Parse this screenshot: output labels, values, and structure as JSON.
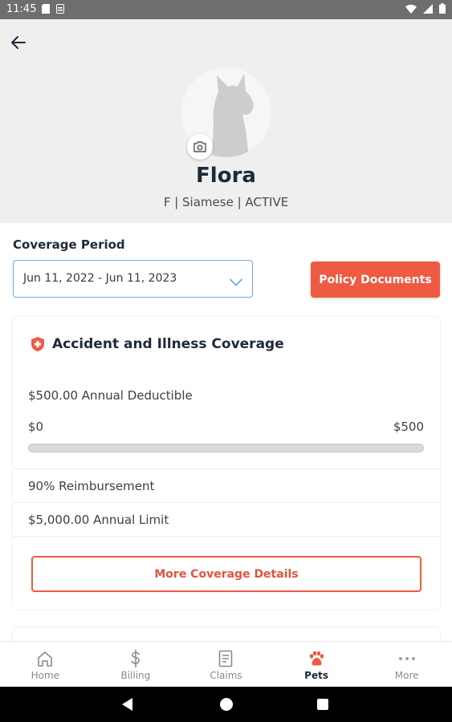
{
  "status_bar": {
    "time": "11:45"
  },
  "header": {
    "pet_name": "Flora",
    "pet_subtitle": "F | Siamese | ACTIVE"
  },
  "coverage": {
    "label": "Coverage Period",
    "period_value": "Jun 11, 2022 - Jun 11, 2023",
    "policy_button": "Policy Documents"
  },
  "card": {
    "title": "Accident and Illness Coverage",
    "deductible": "$500.00 Annual Deductible",
    "range_min": "$0",
    "range_max": "$500",
    "deductible_progress": 0,
    "reimbursement": "90% Reimbursement",
    "annual_limit": "$5,000.00  Annual Limit",
    "more_button": "More Coverage Details"
  },
  "tabs": [
    {
      "label": "Home",
      "icon": "home-icon",
      "active": false
    },
    {
      "label": "Billing",
      "icon": "dollar-icon",
      "active": false
    },
    {
      "label": "Claims",
      "icon": "document-icon",
      "active": false
    },
    {
      "label": "Pets",
      "icon": "paw-icon",
      "active": true
    },
    {
      "label": "More",
      "icon": "more-dots-icon",
      "active": false
    }
  ],
  "colors": {
    "accent": "#ef5a42",
    "select_border": "#6aa9e6",
    "header_bg": "#efefef",
    "text_dark": "#1c2a3b"
  }
}
